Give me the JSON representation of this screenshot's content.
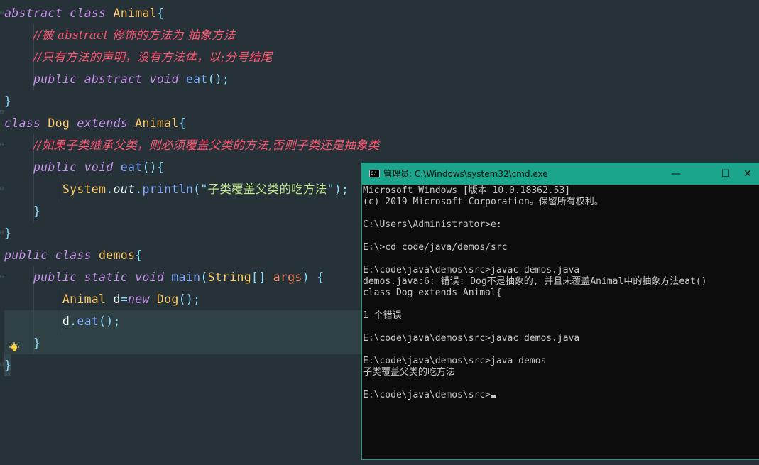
{
  "editor": {
    "lines": [
      [
        {
          "c": "kw",
          "t": "abstract"
        },
        {
          "c": "plain",
          "t": " "
        },
        {
          "c": "kw",
          "t": "class"
        },
        {
          "c": "plain",
          "t": " "
        },
        {
          "c": "cls",
          "t": "Animal"
        },
        {
          "c": "op",
          "t": "{"
        }
      ],
      [
        {
          "c": "plain",
          "t": "    "
        },
        {
          "c": "cm",
          "t": "//被 abstract 修饰的方法为 抽象方法"
        }
      ],
      [
        {
          "c": "plain",
          "t": "    "
        },
        {
          "c": "cm",
          "t": "//只有方法的声明，没有方法体，以;分号结尾"
        }
      ],
      [
        {
          "c": "plain",
          "t": "    "
        },
        {
          "c": "kw",
          "t": "public"
        },
        {
          "c": "plain",
          "t": " "
        },
        {
          "c": "kw",
          "t": "abstract"
        },
        {
          "c": "plain",
          "t": " "
        },
        {
          "c": "kw",
          "t": "void"
        },
        {
          "c": "plain",
          "t": " "
        },
        {
          "c": "fn",
          "t": "eat"
        },
        {
          "c": "op",
          "t": "();"
        }
      ],
      [
        {
          "c": "op",
          "t": "}"
        }
      ],
      [
        {
          "c": "kw",
          "t": "class"
        },
        {
          "c": "plain",
          "t": " "
        },
        {
          "c": "cls",
          "t": "Dog"
        },
        {
          "c": "plain",
          "t": " "
        },
        {
          "c": "kw",
          "t": "extends"
        },
        {
          "c": "plain",
          "t": " "
        },
        {
          "c": "cls",
          "t": "Animal"
        },
        {
          "c": "op",
          "t": "{"
        }
      ],
      [
        {
          "c": "plain",
          "t": "    "
        },
        {
          "c": "cm",
          "t": "//如果子类继承父类，则必须覆盖父类的方法,否则子类还是抽象类"
        }
      ],
      [
        {
          "c": "plain",
          "t": "    "
        },
        {
          "c": "kw",
          "t": "public"
        },
        {
          "c": "plain",
          "t": " "
        },
        {
          "c": "kw",
          "t": "void"
        },
        {
          "c": "plain",
          "t": " "
        },
        {
          "c": "fn",
          "t": "eat"
        },
        {
          "c": "op",
          "t": "(){"
        }
      ],
      [
        {
          "c": "plain",
          "t": "        "
        },
        {
          "c": "cls",
          "t": "System"
        },
        {
          "c": "op",
          "t": "."
        },
        {
          "c": "fld",
          "t": "out"
        },
        {
          "c": "op",
          "t": "."
        },
        {
          "c": "fn",
          "t": "println"
        },
        {
          "c": "op",
          "t": "(\""
        },
        {
          "c": "str",
          "t": "子类覆盖父类的吃方法"
        },
        {
          "c": "op",
          "t": "\");"
        }
      ],
      [
        {
          "c": "plain",
          "t": "    "
        },
        {
          "c": "op",
          "t": "}"
        }
      ],
      [
        {
          "c": "op",
          "t": "}"
        }
      ],
      [
        {
          "c": "kw",
          "t": "public"
        },
        {
          "c": "plain",
          "t": " "
        },
        {
          "c": "kw",
          "t": "class"
        },
        {
          "c": "plain",
          "t": " "
        },
        {
          "c": "cls",
          "t": "demos"
        },
        {
          "c": "op",
          "t": "{"
        }
      ],
      [
        {
          "c": "plain",
          "t": "    "
        },
        {
          "c": "kw",
          "t": "public"
        },
        {
          "c": "plain",
          "t": " "
        },
        {
          "c": "kw",
          "t": "static"
        },
        {
          "c": "plain",
          "t": " "
        },
        {
          "c": "kw",
          "t": "void"
        },
        {
          "c": "plain",
          "t": " "
        },
        {
          "c": "fn",
          "t": "main"
        },
        {
          "c": "op",
          "t": "("
        },
        {
          "c": "cls",
          "t": "String"
        },
        {
          "c": "op",
          "t": "[]"
        },
        {
          "c": "plain",
          "t": " "
        },
        {
          "c": "cm2",
          "t": "args"
        },
        {
          "c": "op",
          "t": ")"
        },
        {
          "c": "plain",
          "t": " "
        },
        {
          "c": "op",
          "t": "{"
        }
      ],
      [
        {
          "c": "plain",
          "t": "        "
        },
        {
          "c": "cls",
          "t": "Animal"
        },
        {
          "c": "plain",
          "t": " d"
        },
        {
          "c": "op",
          "t": "="
        },
        {
          "c": "kw",
          "t": "new"
        },
        {
          "c": "plain",
          "t": " "
        },
        {
          "c": "cls",
          "t": "Dog"
        },
        {
          "c": "op",
          "t": "();"
        }
      ],
      [
        {
          "c": "plain",
          "t": "        d"
        },
        {
          "c": "op",
          "t": "."
        },
        {
          "c": "fn",
          "t": "eat"
        },
        {
          "c": "op",
          "t": "();"
        }
      ],
      [
        {
          "c": "plain",
          "t": "    "
        },
        {
          "c": "op",
          "t": "}"
        }
      ],
      [
        {
          "c": "op",
          "t": "}"
        }
      ]
    ]
  },
  "cmd": {
    "title": "管理员: C:\\Windows\\system32\\cmd.exe",
    "icon_text": "C:\\",
    "minimize": "—",
    "maximize": "☐",
    "close": "✕",
    "lines": [
      "Microsoft Windows [版本 10.0.18362.53]",
      "(c) 2019 Microsoft Corporation。保留所有权利。",
      "",
      "C:\\Users\\Administrator>e:",
      "",
      "E:\\>cd code/java/demos/src",
      "",
      "E:\\code\\java\\demos\\src>javac demos.java",
      "demos.java:6: 错误: Dog不是抽象的, 并且未覆盖Animal中的抽象方法eat()",
      "class Dog extends Animal{",
      "",
      "1 个错误",
      "",
      "E:\\code\\java\\demos\\src>javac demos.java",
      "",
      "E:\\code\\java\\demos\\src>java demos",
      "子类覆盖父类的吃方法",
      "",
      "E:\\code\\java\\demos\\src>"
    ]
  }
}
